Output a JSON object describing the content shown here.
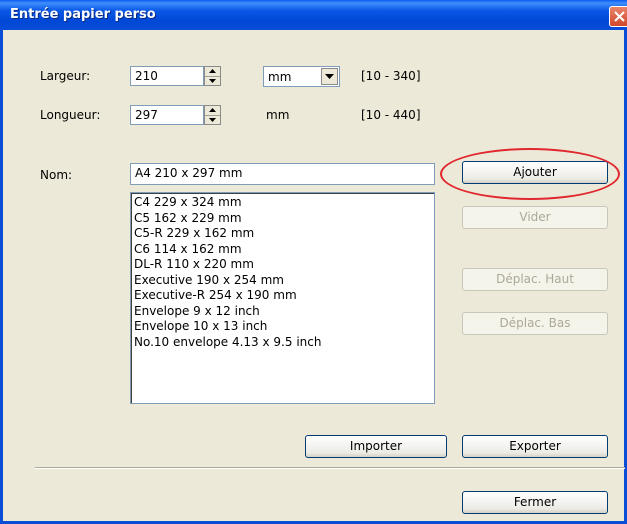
{
  "window": {
    "title": "Entrée papier perso"
  },
  "form": {
    "width_label": "Largeur:",
    "width_value": "210",
    "unit_value": "mm",
    "width_range": "[10 - 340]",
    "length_label": "Longueur:",
    "length_value": "297",
    "length_unit": "mm",
    "length_range": "[10 - 440]",
    "name_label": "Nom:",
    "name_value": "A4 210 x 297 mm"
  },
  "paper_list": [
    "C4 229 x 324 mm",
    "C5 162 x 229 mm",
    "C5-R 229 x 162 mm",
    "C6 114 x 162 mm",
    "DL-R 110 x 220 mm",
    "Executive 190 x 254 mm",
    "Executive-R 254 x 190 mm",
    "Envelope 9 x 12 inch",
    "Envelope 10 x 13 inch",
    "No.10 envelope 4.13 x 9.5 inch"
  ],
  "buttons": {
    "add": "Ajouter",
    "clear": "Vider",
    "move_up": "Déplac. Haut",
    "move_down": "Déplac. Bas",
    "import": "Importer",
    "export": "Exporter",
    "close": "Fermer"
  },
  "icons": {
    "close": "close-icon",
    "spin_up": "chevron-up-icon",
    "spin_down": "chevron-down-icon",
    "dropdown": "dropdown-arrow-icon"
  },
  "colors": {
    "titlebar": "#0a4ed8",
    "window_bg": "#ece9d8",
    "highlight": "#e0282e",
    "disabled_text": "#aca899"
  }
}
